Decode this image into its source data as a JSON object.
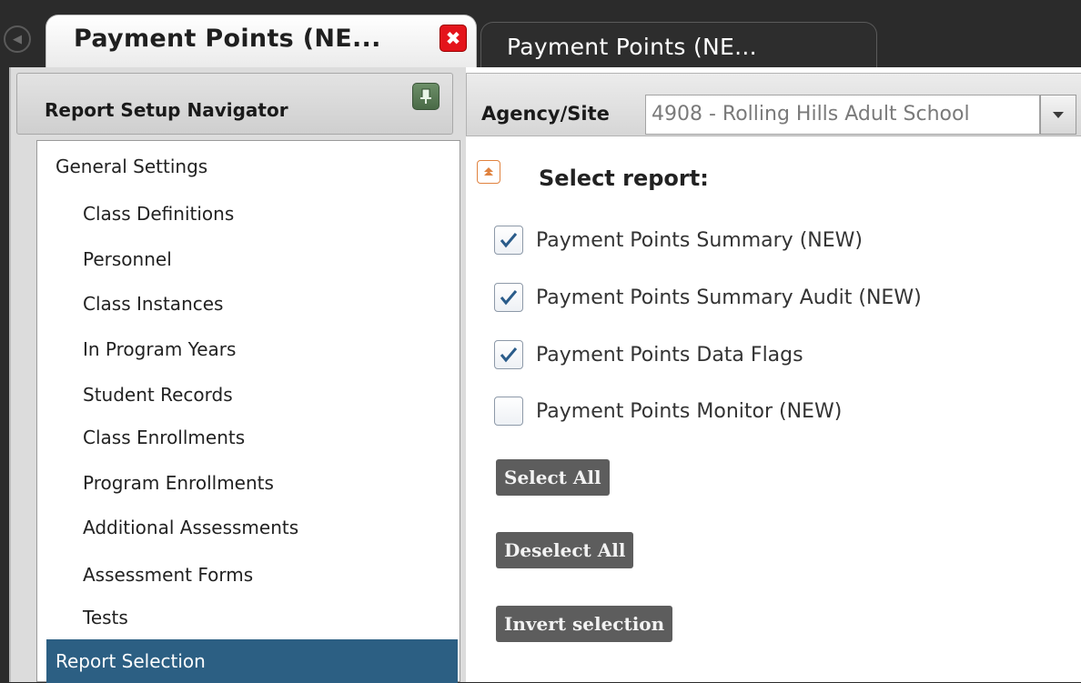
{
  "tabs": [
    {
      "title": "Payment Points (NE...",
      "active": true
    },
    {
      "title": "Payment Points (NE...",
      "active": false
    }
  ],
  "navigator": {
    "title": "Report Setup Navigator",
    "items": [
      {
        "label": "General Settings",
        "level": 0
      },
      {
        "label": "Class Definitions",
        "level": 1
      },
      {
        "label": "Personnel",
        "level": 1
      },
      {
        "label": "Class Instances",
        "level": 1
      },
      {
        "label": "In Program Years",
        "level": 1
      },
      {
        "label": "Student Records",
        "level": 1
      },
      {
        "label": "Class Enrollments",
        "level": 1
      },
      {
        "label": "Program Enrollments",
        "level": 1
      },
      {
        "label": "Additional Assessments",
        "level": 1
      },
      {
        "label": "Assessment Forms",
        "level": 1
      },
      {
        "label": "Tests",
        "level": 1
      },
      {
        "label": "Report Selection",
        "level": 0,
        "selected": true
      }
    ]
  },
  "agency": {
    "label": "Agency/Site",
    "value": "4908 - Rolling Hills Adult School"
  },
  "report_section": {
    "title": "Select report:",
    "reports": [
      {
        "label": "Payment Points Summary (NEW)",
        "checked": true
      },
      {
        "label": "Payment Points Summary Audit (NEW)",
        "checked": true
      },
      {
        "label": "Payment Points Data Flags",
        "checked": true
      },
      {
        "label": "Payment Points Monitor (NEW)",
        "checked": false
      }
    ],
    "buttons": {
      "select_all": "Select All",
      "deselect_all": "Deselect All",
      "invert": "Invert selection"
    }
  },
  "colors": {
    "selected_nav": "#2c5f83",
    "close_red": "#e4141b",
    "pin_green": "#5a7c56",
    "button_gray": "#5d5d5d",
    "check_blue": "#2a5c8a",
    "collapse_orange": "#e0823f"
  },
  "icons": {
    "scroll_left": "chevron-left-icon",
    "close": "close-icon",
    "pin": "pin-icon",
    "dropdown": "chevron-down-icon",
    "collapse": "collapse-up-icon",
    "check": "checkmark-icon"
  }
}
